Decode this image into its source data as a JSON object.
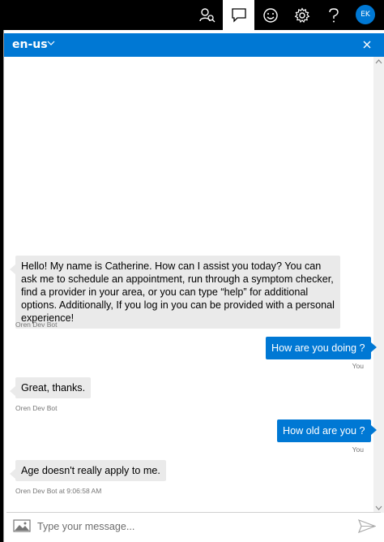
{
  "topbar": {
    "icons": [
      "contact-search-icon",
      "chat-icon",
      "smiley-icon",
      "gear-icon",
      "help-icon"
    ],
    "active": "chat-icon",
    "avatar_initials": "EK"
  },
  "header": {
    "locale": "en-us",
    "accent": "#0078d4"
  },
  "messages": [
    {
      "from": "bot",
      "text": "Hello! My name is Catherine. How can I assist you today? You can ask me to schedule an appointment, run through a symptom checker, find a provider in your area, or you can type “help” for additional options. Additionally, If you log in you can be provided with a personal experience!",
      "meta": "Oren Dev Bot"
    },
    {
      "from": "user",
      "text": "How are you doing ?",
      "meta": "You"
    },
    {
      "from": "bot",
      "text": "Great, thanks.",
      "meta": "Oren Dev Bot"
    },
    {
      "from": "user",
      "text": "How old are you ?",
      "meta": "You"
    },
    {
      "from": "bot",
      "text": "Age doesn't really apply to me.",
      "meta": "Oren Dev Bot at 9:06:58 AM"
    }
  ],
  "composer": {
    "placeholder": "Type your message..."
  }
}
